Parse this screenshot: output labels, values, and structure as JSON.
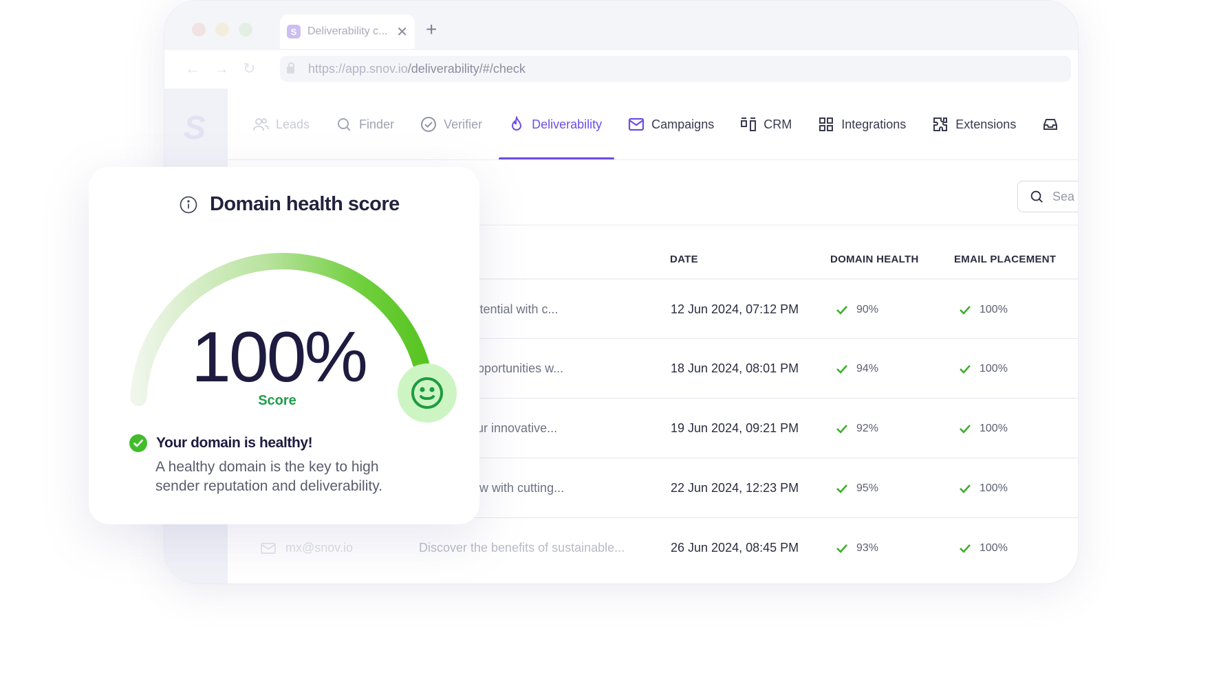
{
  "browser": {
    "tab_title": "Deliverability c...",
    "tab_favicon_letter": "S",
    "tab_close": "✕",
    "new_tab": "+",
    "url_host": "https://app.snov.io",
    "url_path": "/deliverability/#/check"
  },
  "app": {
    "logo_letter": "S"
  },
  "nav": {
    "items": [
      {
        "label": "Leads",
        "icon": "people-icon"
      },
      {
        "label": "Finder",
        "icon": "search-icon"
      },
      {
        "label": "Verifier",
        "icon": "check-circle-icon"
      },
      {
        "label": "Deliverability",
        "icon": "flame-icon",
        "active": true
      },
      {
        "label": "Campaigns",
        "icon": "mail-icon"
      },
      {
        "label": "CRM",
        "icon": "crm-icon"
      },
      {
        "label": "Integrations",
        "icon": "grid-icon"
      },
      {
        "label": "Extensions",
        "icon": "puzzle-icon"
      }
    ]
  },
  "search": {
    "placeholder": "Sea"
  },
  "table": {
    "headers": {
      "date": "DATE",
      "domain_health": "DOMAIN HEALTH",
      "email_placement": "EMAIL PLACEMENT"
    },
    "rows": [
      {
        "subject": "r team's potential with c...",
        "date": "12 Jun 2024, 07:12 PM",
        "domain_health": "90%",
        "email_placement": "100%"
      },
      {
        "subject": "rtnership opportunities w...",
        "date": "18 Jun 2024, 08:01 PM",
        "domain_health": "94%",
        "email_placement": "100%"
      },
      {
        "subject": "ROI with our innovative...",
        "date": "19 Jun 2024, 09:21 PM",
        "domain_health": "92%",
        "email_placement": "100%"
      },
      {
        "subject": "our workflow with cutting...",
        "date": "22 Jun 2024, 12:23 PM",
        "domain_health": "95%",
        "email_placement": "100%"
      },
      {
        "subject": "Discover the benefits of sustainable...",
        "date": "26 Jun 2024, 08:45 PM",
        "domain_health": "93%",
        "email_placement": "100%"
      }
    ],
    "last_sender": "mx@snov.io"
  },
  "card": {
    "title": "Domain health score",
    "value": "100%",
    "gauge_fraction": 1.0,
    "score_label": "Score",
    "status_title": "Your domain is healthy!",
    "status_description": "A healthy domain is the key to high sender reputation and deliverability."
  },
  "colors": {
    "accent": "#6b4ee6",
    "success": "#4cbf1f",
    "success_text": "#1f9d4a"
  }
}
